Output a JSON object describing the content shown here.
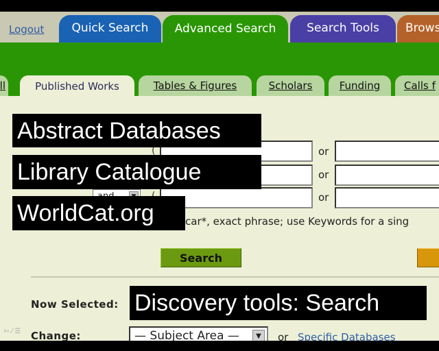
{
  "header": {
    "logout_label": "Logout",
    "main_tabs": [
      {
        "label": "Quick Search",
        "color": "#1a62b4"
      },
      {
        "label": "Advanced Search",
        "color": "#2a9605",
        "active": true
      },
      {
        "label": "Search Tools",
        "color": "#4a3fa5"
      },
      {
        "label": "Brows",
        "color": "#b5622a"
      }
    ]
  },
  "sub_tabs": [
    {
      "label": "ll"
    },
    {
      "label": "Published Works",
      "active": true
    },
    {
      "label": "Tables & Figures"
    },
    {
      "label": "Scholars"
    },
    {
      "label": "Funding"
    },
    {
      "label": "Calls f"
    }
  ],
  "search_form": {
    "rows": [
      {
        "paren_open": "(",
        "or_label": "or",
        "value1": "",
        "value2": ""
      },
      {
        "paren_open": "",
        "or_label": "or",
        "value1": "",
        "value2": ""
      },
      {
        "operator": "and",
        "paren_open": "(",
        "or_label": "or",
        "value1": "",
        "value2": ""
      }
    ],
    "hint_text": "car*, exact phrase; use Keywords for a sing",
    "search_button": "Search"
  },
  "selection": {
    "now_selected_label": "Now Selected:",
    "change_label": "Change:",
    "subject_area_value": "— Subject Area —",
    "or_label": "or",
    "specific_databases_link": "Specific Databases"
  },
  "overlays": [
    "Abstract Databases",
    "Library Catalogue",
    "WorldCat.org",
    "Discovery tools: Search"
  ],
  "colors": {
    "green_band": "#2a9605",
    "content_bg": "#edf0d6",
    "subtab_bg": "#b7d59f",
    "link_blue": "#2e5da5",
    "search_btn": "#6b9a10",
    "orange_btn": "#d8960a"
  }
}
